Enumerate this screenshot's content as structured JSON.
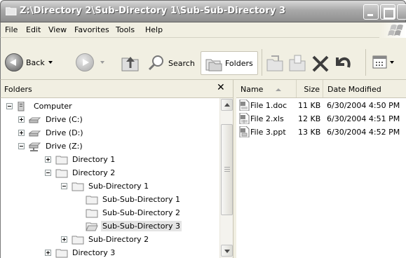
{
  "window": {
    "title": "Z:\\Directory 2\\Sub-Directory 1\\Sub-Sub-Directory 3",
    "colors": {
      "chrome": "#f1efe2",
      "selection": "#e4e4e4",
      "titlebar": "#9a9a9a"
    }
  },
  "menu": [
    {
      "label": "File"
    },
    {
      "label": "Edit"
    },
    {
      "label": "View"
    },
    {
      "label": "Favorites"
    },
    {
      "label": "Tools"
    },
    {
      "label": "Help"
    }
  ],
  "toolbar": {
    "back_label": "Back",
    "search_label": "Search",
    "folders_label": "Folders"
  },
  "folders_pane": {
    "title": "Folders",
    "close_glyph": "✕"
  },
  "tree": [
    {
      "label": "Computer"
    },
    {
      "label": "Drive (C:)"
    },
    {
      "label": "Drive (D:)"
    },
    {
      "label": "Drive (Z:)"
    },
    {
      "label": "Directory 1"
    },
    {
      "label": "Directory 2"
    },
    {
      "label": "Sub-Directory 1"
    },
    {
      "label": "Sub-Sub-Directory 1"
    },
    {
      "label": "Sub-Sub-Directory 2"
    },
    {
      "label": "Sub-Sub-Directory 3",
      "selected": true
    },
    {
      "label": "Sub-Directory 2"
    },
    {
      "label": "Directory 3"
    }
  ],
  "file_list": {
    "columns": {
      "name": "Name",
      "size": "Size",
      "date": "Date Modified"
    },
    "files": [
      {
        "name": "File 1.doc",
        "size": "11 KB",
        "date": "6/30/2004 4:50 PM"
      },
      {
        "name": "File 2.xls",
        "size": "12 KB",
        "date": "6/30/2004 4:51 PM"
      },
      {
        "name": "File 3.ppt",
        "size": "13 KB",
        "date": "6/30/2004 4:52 PM"
      }
    ]
  }
}
